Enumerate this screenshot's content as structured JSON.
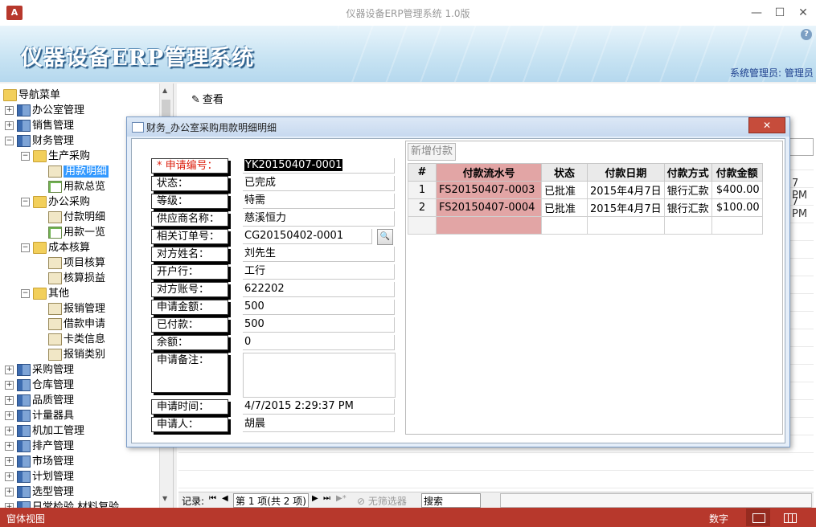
{
  "window": {
    "title": "仪器设备ERP管理系统 1.0版",
    "app_icon": "A",
    "min": "—",
    "max": "☐",
    "close": "✕"
  },
  "banner": {
    "title": "仪器设备ERP管理系统",
    "user_info": "系统管理员: 管理员",
    "help": "?"
  },
  "nav": {
    "header": "导航菜单",
    "items": [
      {
        "label": "办公室管理"
      },
      {
        "label": "销售管理"
      },
      {
        "label": "财务管理"
      },
      {
        "label": "生产采购"
      },
      {
        "label": "用款明细"
      },
      {
        "label": "用款总览"
      },
      {
        "label": "办公采购"
      },
      {
        "label": "付款明细"
      },
      {
        "label": "用款一览"
      },
      {
        "label": "成本核算"
      },
      {
        "label": "项目核算"
      },
      {
        "label": "核算损益"
      },
      {
        "label": "其他"
      },
      {
        "label": "报销管理"
      },
      {
        "label": "借款申请"
      },
      {
        "label": "卡类信息"
      },
      {
        "label": "报销类别"
      },
      {
        "label": "采购管理"
      },
      {
        "label": "仓库管理"
      },
      {
        "label": "品质管理"
      },
      {
        "label": "计量器具"
      },
      {
        "label": "机加工管理"
      },
      {
        "label": "排产管理"
      },
      {
        "label": "市场管理"
      },
      {
        "label": "计划管理"
      },
      {
        "label": "选型管理"
      },
      {
        "label": "日常检验 材料复验"
      }
    ]
  },
  "toolbar": {
    "view_label": "查看"
  },
  "background": {
    "pm1": "7 PM",
    "pm2": "7 PM"
  },
  "dialog": {
    "title": "财务_办公室采购用款明细明细",
    "close": "✕",
    "fields": {
      "apply_no": {
        "label": "* 申请编号：",
        "value": "YK20150407-0001"
      },
      "status": {
        "label": "状态：",
        "value": "已完成"
      },
      "level": {
        "label": "等级：",
        "value": "特需"
      },
      "supplier": {
        "label": "供应商名称：",
        "value": "慈溪恒力"
      },
      "order_no": {
        "label": "相关订单号：",
        "value": "CG20150402-0001"
      },
      "contact": {
        "label": "对方姓名：",
        "value": "刘先生"
      },
      "bank": {
        "label": "开户行：",
        "value": "工行"
      },
      "account": {
        "label": "对方账号：",
        "value": "622202"
      },
      "amount": {
        "label": "申请金额：",
        "value": "500"
      },
      "paid": {
        "label": "已付款：",
        "value": "500"
      },
      "balance": {
        "label": "余额：",
        "value": "0"
      },
      "notes": {
        "label": "申请备注：",
        "value": ""
      },
      "apply_time": {
        "label": "申请时间：",
        "value": "4/7/2015 2:29:37 PM"
      },
      "applicant": {
        "label": "申请人：",
        "value": "胡晨"
      }
    },
    "subform": {
      "add_label": "新增付款",
      "columns": [
        "#",
        "付款流水号",
        "状态",
        "付款日期",
        "付款方式",
        "付款金额"
      ],
      "rows": [
        {
          "n": "1",
          "serial": "FS20150407-0003",
          "status": "已批准",
          "date": "2015年4月7日",
          "method": "银行汇款",
          "amount": "$400.00"
        },
        {
          "n": "2",
          "serial": "FS20150407-0004",
          "status": "已批准",
          "date": "2015年4月7日",
          "method": "银行汇款",
          "amount": "$100.00"
        }
      ]
    }
  },
  "recordbar": {
    "label": "记录:",
    "first": "⏮",
    "prev": "◀",
    "position": "第 1 项(共 2 项)",
    "next": "▶",
    "last": "⏭",
    "new": "▶*",
    "filter": "无筛选器",
    "search": "搜索"
  },
  "statusbar": {
    "left": "窗体视图",
    "right": "数字"
  },
  "colors": {
    "accent": "#b7382c",
    "highlight": "#3399ff",
    "pink_column": "#e2a5a5"
  }
}
